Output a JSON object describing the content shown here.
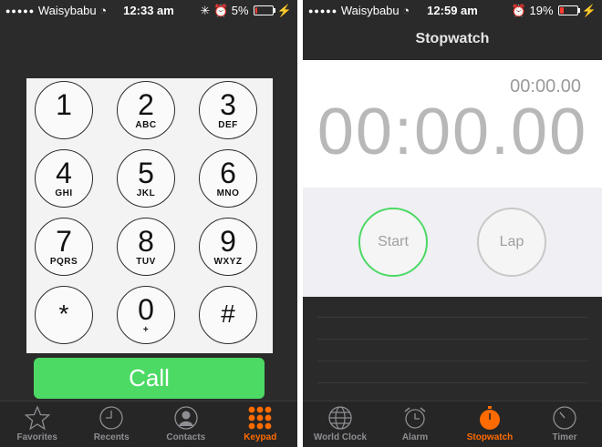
{
  "phone_screen": {
    "status": {
      "carrier": "Waisybabu",
      "time": "12:33 am",
      "battery": "5%",
      "battery_level": 0.05
    },
    "keys": [
      {
        "num": "1",
        "letters": ""
      },
      {
        "num": "2",
        "letters": "ABC"
      },
      {
        "num": "3",
        "letters": "DEF"
      },
      {
        "num": "4",
        "letters": "GHI"
      },
      {
        "num": "5",
        "letters": "JKL"
      },
      {
        "num": "6",
        "letters": "MNO"
      },
      {
        "num": "7",
        "letters": "PQRS"
      },
      {
        "num": "8",
        "letters": "TUV"
      },
      {
        "num": "9",
        "letters": "WXYZ"
      },
      {
        "num": "*",
        "letters": ""
      },
      {
        "num": "0",
        "letters": "+"
      },
      {
        "num": "#",
        "letters": ""
      }
    ],
    "call_label": "Call",
    "tabs": [
      {
        "label": "Favorites",
        "icon": "star-icon"
      },
      {
        "label": "Recents",
        "icon": "clock-icon"
      },
      {
        "label": "Contacts",
        "icon": "contact-icon"
      },
      {
        "label": "Keypad",
        "icon": "keypad-icon",
        "active": true
      }
    ]
  },
  "stopwatch_screen": {
    "status": {
      "carrier": "Waisybabu",
      "time": "12:59 am",
      "battery": "19%",
      "battery_level": 0.19
    },
    "title": "Stopwatch",
    "lap_time": "00:00.00",
    "main_time": "00:00.00",
    "start_label": "Start",
    "lap_label": "Lap",
    "tabs": [
      {
        "label": "World Clock",
        "icon": "globe-icon"
      },
      {
        "label": "Alarm",
        "icon": "alarm-icon"
      },
      {
        "label": "Stopwatch",
        "icon": "stopwatch-icon",
        "active": true
      },
      {
        "label": "Timer",
        "icon": "timer-icon"
      }
    ]
  },
  "colors": {
    "accent_orange": "#ff6b00",
    "call_green": "#4cd964",
    "battery_red": "#ff3b30"
  }
}
